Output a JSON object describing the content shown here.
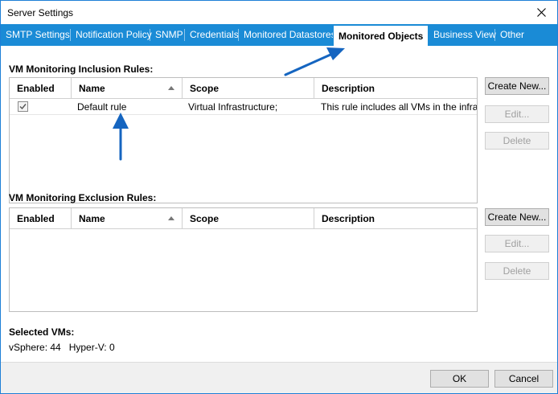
{
  "window": {
    "title": "Server Settings"
  },
  "tabs": [
    {
      "label": "SMTP Settings"
    },
    {
      "label": "Notification Policy"
    },
    {
      "label": "SNMP"
    },
    {
      "label": "Credentials"
    },
    {
      "label": "Monitored Datastores"
    },
    {
      "label": "Monitored Objects",
      "active": true
    },
    {
      "label": "Business View"
    },
    {
      "label": "Other"
    }
  ],
  "inclusion": {
    "label": "VM Monitoring Inclusion Rules:",
    "columns": {
      "enabled": "Enabled",
      "name": "Name",
      "scope": "Scope",
      "description": "Description"
    },
    "rows": [
      {
        "enabled": true,
        "name": "Default rule",
        "scope": "Virtual Infrastructure;",
        "description": "This rule includes all VMs in the infras..."
      }
    ],
    "buttons": {
      "create": "Create New...",
      "edit": "Edit...",
      "delete": "Delete"
    }
  },
  "exclusion": {
    "label": "VM Monitoring Exclusion Rules:",
    "columns": {
      "enabled": "Enabled",
      "name": "Name",
      "scope": "Scope",
      "description": "Description"
    },
    "rows": [],
    "buttons": {
      "create": "Create New...",
      "edit": "Edit...",
      "delete": "Delete"
    }
  },
  "selected": {
    "label": "Selected VMs:",
    "summary": "vSphere: 44   Hyper-V: 0"
  },
  "footer": {
    "ok": "OK",
    "cancel": "Cancel"
  },
  "colors": {
    "tabstrip": "#1a8bd6",
    "annotation_arrow": "#1565c0"
  }
}
